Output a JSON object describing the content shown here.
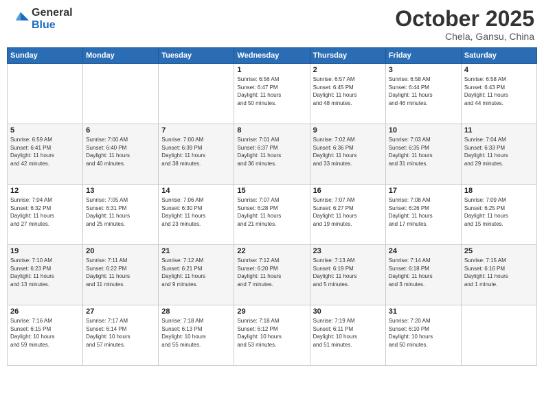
{
  "header": {
    "logo_general": "General",
    "logo_blue": "Blue",
    "month": "October 2025",
    "location": "Chela, Gansu, China"
  },
  "days_of_week": [
    "Sunday",
    "Monday",
    "Tuesday",
    "Wednesday",
    "Thursday",
    "Friday",
    "Saturday"
  ],
  "weeks": [
    [
      {
        "day": "",
        "info": ""
      },
      {
        "day": "",
        "info": ""
      },
      {
        "day": "",
        "info": ""
      },
      {
        "day": "1",
        "info": "Sunrise: 6:56 AM\nSunset: 6:47 PM\nDaylight: 11 hours\nand 50 minutes."
      },
      {
        "day": "2",
        "info": "Sunrise: 6:57 AM\nSunset: 6:45 PM\nDaylight: 11 hours\nand 48 minutes."
      },
      {
        "day": "3",
        "info": "Sunrise: 6:58 AM\nSunset: 6:44 PM\nDaylight: 11 hours\nand 46 minutes."
      },
      {
        "day": "4",
        "info": "Sunrise: 6:58 AM\nSunset: 6:43 PM\nDaylight: 11 hours\nand 44 minutes."
      }
    ],
    [
      {
        "day": "5",
        "info": "Sunrise: 6:59 AM\nSunset: 6:41 PM\nDaylight: 11 hours\nand 42 minutes."
      },
      {
        "day": "6",
        "info": "Sunrise: 7:00 AM\nSunset: 6:40 PM\nDaylight: 11 hours\nand 40 minutes."
      },
      {
        "day": "7",
        "info": "Sunrise: 7:00 AM\nSunset: 6:39 PM\nDaylight: 11 hours\nand 38 minutes."
      },
      {
        "day": "8",
        "info": "Sunrise: 7:01 AM\nSunset: 6:37 PM\nDaylight: 11 hours\nand 36 minutes."
      },
      {
        "day": "9",
        "info": "Sunrise: 7:02 AM\nSunset: 6:36 PM\nDaylight: 11 hours\nand 33 minutes."
      },
      {
        "day": "10",
        "info": "Sunrise: 7:03 AM\nSunset: 6:35 PM\nDaylight: 11 hours\nand 31 minutes."
      },
      {
        "day": "11",
        "info": "Sunrise: 7:04 AM\nSunset: 6:33 PM\nDaylight: 11 hours\nand 29 minutes."
      }
    ],
    [
      {
        "day": "12",
        "info": "Sunrise: 7:04 AM\nSunset: 6:32 PM\nDaylight: 11 hours\nand 27 minutes."
      },
      {
        "day": "13",
        "info": "Sunrise: 7:05 AM\nSunset: 6:31 PM\nDaylight: 11 hours\nand 25 minutes."
      },
      {
        "day": "14",
        "info": "Sunrise: 7:06 AM\nSunset: 6:30 PM\nDaylight: 11 hours\nand 23 minutes."
      },
      {
        "day": "15",
        "info": "Sunrise: 7:07 AM\nSunset: 6:28 PM\nDaylight: 11 hours\nand 21 minutes."
      },
      {
        "day": "16",
        "info": "Sunrise: 7:07 AM\nSunset: 6:27 PM\nDaylight: 11 hours\nand 19 minutes."
      },
      {
        "day": "17",
        "info": "Sunrise: 7:08 AM\nSunset: 6:26 PM\nDaylight: 11 hours\nand 17 minutes."
      },
      {
        "day": "18",
        "info": "Sunrise: 7:09 AM\nSunset: 6:25 PM\nDaylight: 11 hours\nand 15 minutes."
      }
    ],
    [
      {
        "day": "19",
        "info": "Sunrise: 7:10 AM\nSunset: 6:23 PM\nDaylight: 11 hours\nand 13 minutes."
      },
      {
        "day": "20",
        "info": "Sunrise: 7:11 AM\nSunset: 6:22 PM\nDaylight: 11 hours\nand 11 minutes."
      },
      {
        "day": "21",
        "info": "Sunrise: 7:12 AM\nSunset: 6:21 PM\nDaylight: 11 hours\nand 9 minutes."
      },
      {
        "day": "22",
        "info": "Sunrise: 7:12 AM\nSunset: 6:20 PM\nDaylight: 11 hours\nand 7 minutes."
      },
      {
        "day": "23",
        "info": "Sunrise: 7:13 AM\nSunset: 6:19 PM\nDaylight: 11 hours\nand 5 minutes."
      },
      {
        "day": "24",
        "info": "Sunrise: 7:14 AM\nSunset: 6:18 PM\nDaylight: 11 hours\nand 3 minutes."
      },
      {
        "day": "25",
        "info": "Sunrise: 7:15 AM\nSunset: 6:16 PM\nDaylight: 11 hours\nand 1 minute."
      }
    ],
    [
      {
        "day": "26",
        "info": "Sunrise: 7:16 AM\nSunset: 6:15 PM\nDaylight: 10 hours\nand 59 minutes."
      },
      {
        "day": "27",
        "info": "Sunrise: 7:17 AM\nSunset: 6:14 PM\nDaylight: 10 hours\nand 57 minutes."
      },
      {
        "day": "28",
        "info": "Sunrise: 7:18 AM\nSunset: 6:13 PM\nDaylight: 10 hours\nand 55 minutes."
      },
      {
        "day": "29",
        "info": "Sunrise: 7:18 AM\nSunset: 6:12 PM\nDaylight: 10 hours\nand 53 minutes."
      },
      {
        "day": "30",
        "info": "Sunrise: 7:19 AM\nSunset: 6:11 PM\nDaylight: 10 hours\nand 51 minutes."
      },
      {
        "day": "31",
        "info": "Sunrise: 7:20 AM\nSunset: 6:10 PM\nDaylight: 10 hours\nand 50 minutes."
      },
      {
        "day": "",
        "info": ""
      }
    ]
  ]
}
